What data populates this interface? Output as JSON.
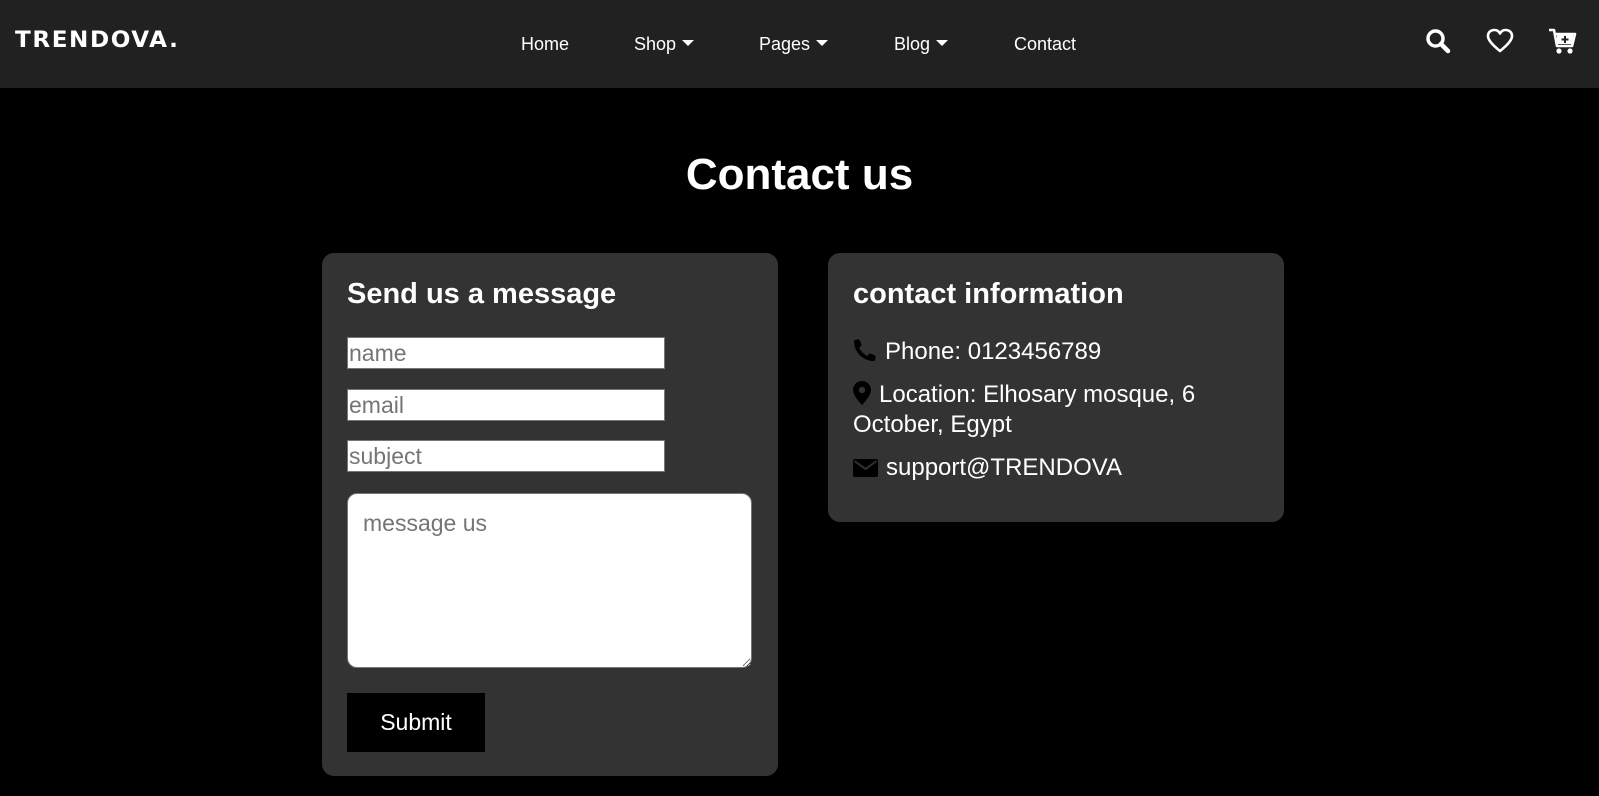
{
  "brand": {
    "logo": "TRENDOVA."
  },
  "nav": {
    "items": [
      {
        "label": "Home",
        "dropdown": false
      },
      {
        "label": "Shop",
        "dropdown": true
      },
      {
        "label": "Pages",
        "dropdown": true
      },
      {
        "label": "Blog",
        "dropdown": true
      },
      {
        "label": "Contact",
        "dropdown": false
      }
    ],
    "icons": [
      "search-icon",
      "heart-icon",
      "cart-plus-icon"
    ]
  },
  "page": {
    "title": "Contact us"
  },
  "form": {
    "title": "Send us a message",
    "name_placeholder": "name",
    "email_placeholder": "email",
    "subject_placeholder": "subject",
    "message_placeholder": "message us",
    "submit_label": "Submit"
  },
  "info": {
    "title": "contact information",
    "phone": "Phone: 0123456789",
    "location": "Location: Elhosary mosque, 6 October, Egypt",
    "email": "support@TRENDOVA"
  },
  "colors": {
    "background": "#000000",
    "navbar": "#212121",
    "card": "#333333",
    "text": "#ffffff"
  }
}
